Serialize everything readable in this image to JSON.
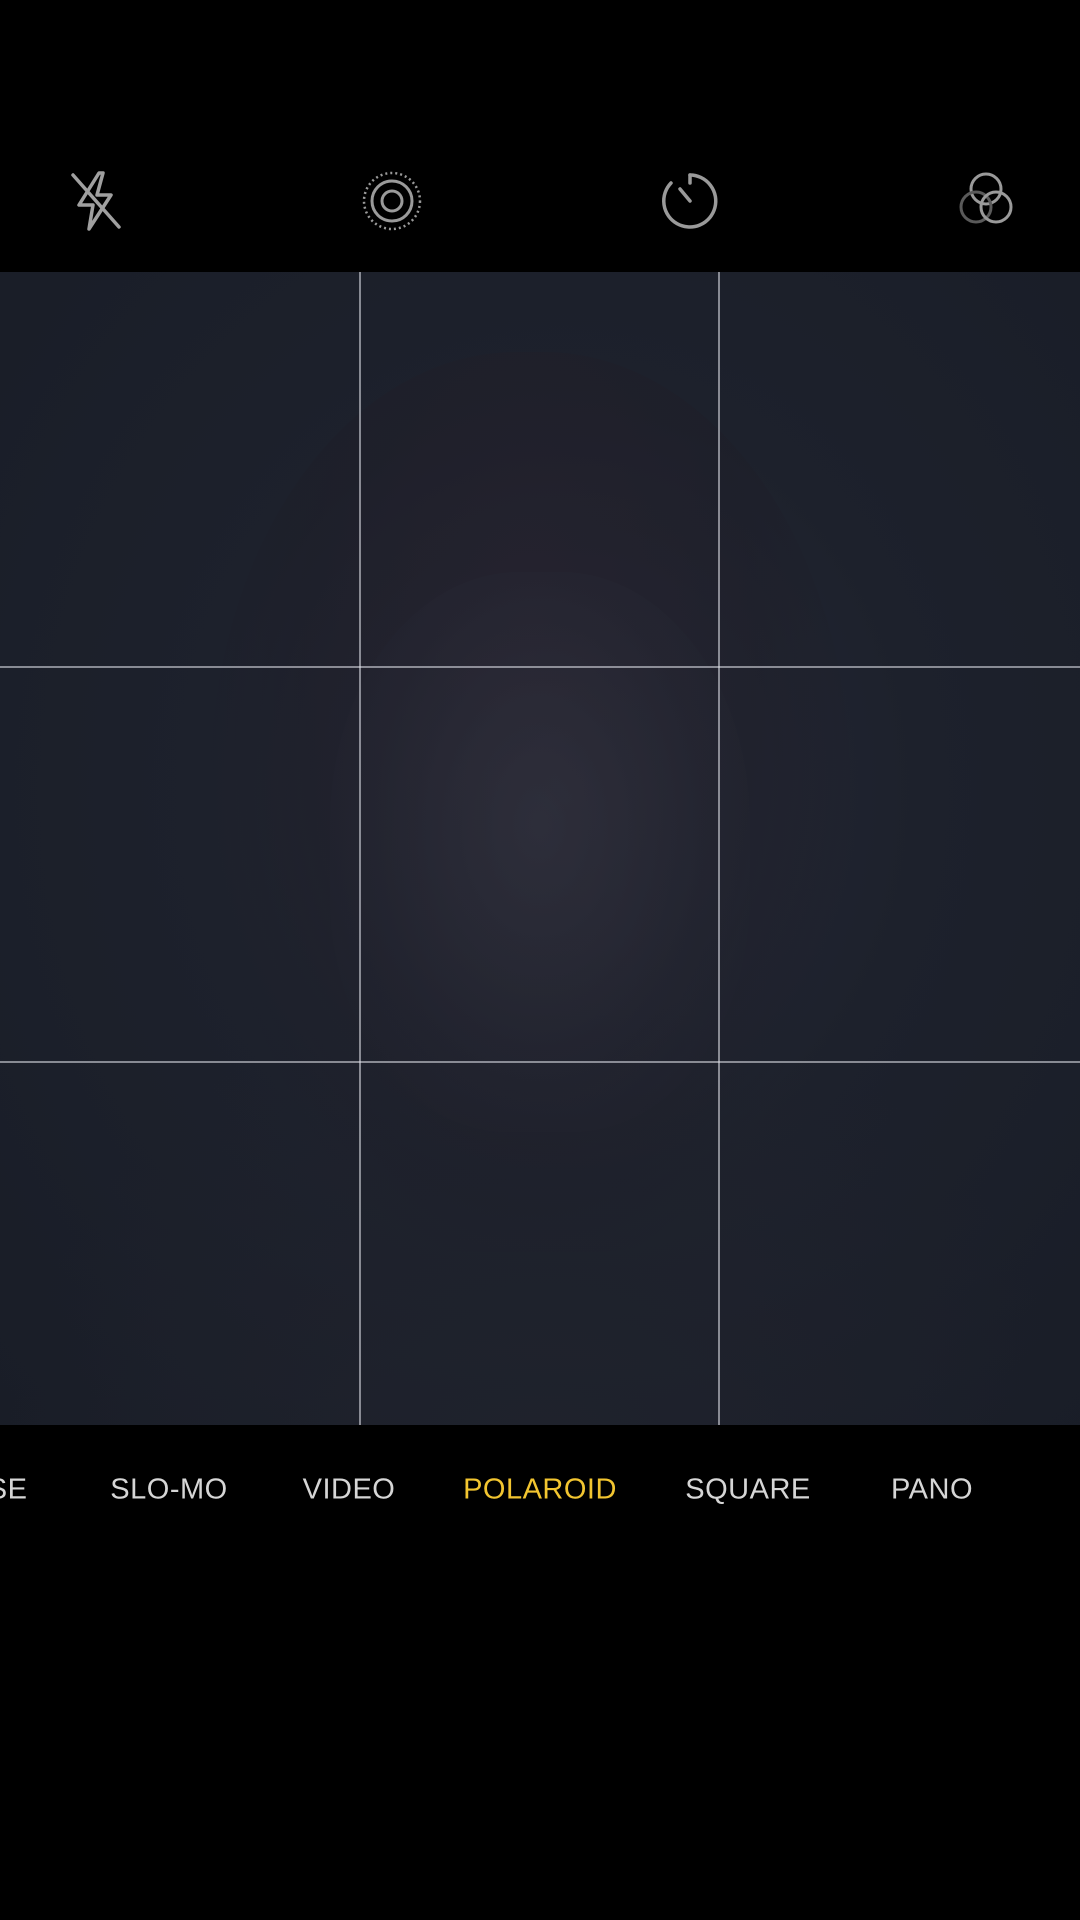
{
  "toolbar": {
    "flash_icon": "flash-off-icon",
    "live_icon": "live-photo-icon",
    "timer_icon": "timer-icon",
    "filter_icon": "filters-icon"
  },
  "viewfinder": {
    "grid": "3x3"
  },
  "modes": {
    "timelapse": "TIME-LAPSE",
    "slomo": "SLO-MO",
    "video": "VIDEO",
    "polaroid": "POLAROID",
    "square": "SQUARE",
    "pano": "PANO",
    "selected": "POLAROID"
  },
  "colors": {
    "active_mode": "#f2c530",
    "inactive_mode": "#d6d6d6",
    "icon": "#9a9a9a",
    "grid": "#e1e4eb"
  }
}
